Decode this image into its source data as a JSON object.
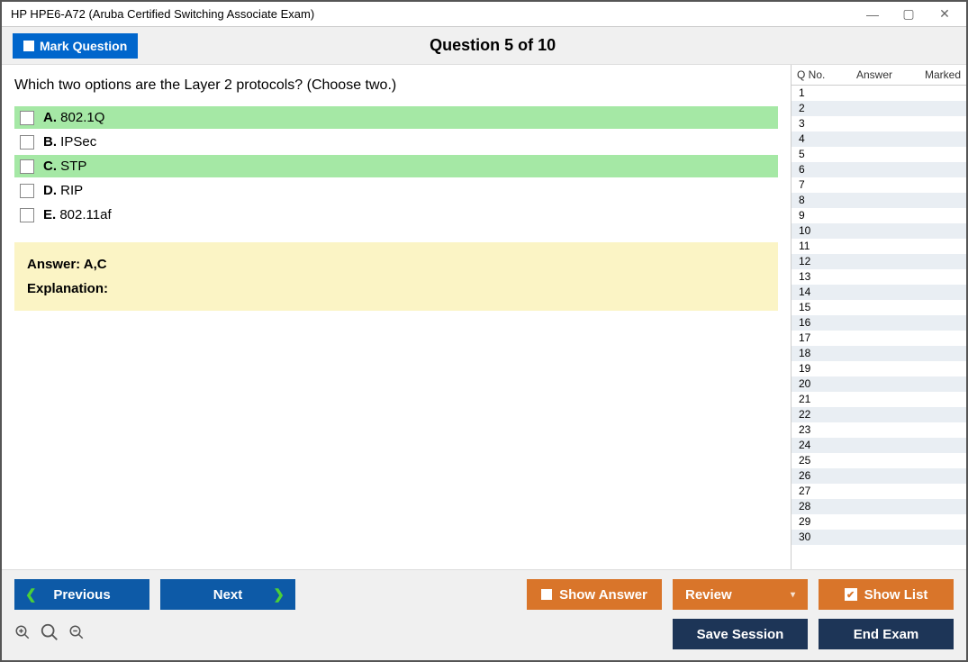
{
  "window": {
    "title": "HP HPE6-A72 (Aruba Certified Switching Associate Exam)"
  },
  "header": {
    "mark_label": "Mark Question",
    "question_title": "Question 5 of 10"
  },
  "question": {
    "text": "Which two options are the Layer 2 protocols? (Choose two.)",
    "options": [
      {
        "letter": "A.",
        "text": "802.1Q",
        "correct": true
      },
      {
        "letter": "B.",
        "text": "IPSec",
        "correct": false
      },
      {
        "letter": "C.",
        "text": "STP",
        "correct": true
      },
      {
        "letter": "D.",
        "text": "RIP",
        "correct": false
      },
      {
        "letter": "E.",
        "text": "802.11af",
        "correct": false
      }
    ],
    "answer_prefix": "Answer: ",
    "answer_value": "A,C",
    "explanation_label": "Explanation:"
  },
  "sidebar": {
    "col_qno": "Q No.",
    "col_answer": "Answer",
    "col_marked": "Marked",
    "rows": [
      {
        "n": "1"
      },
      {
        "n": "2"
      },
      {
        "n": "3"
      },
      {
        "n": "4"
      },
      {
        "n": "5"
      },
      {
        "n": "6"
      },
      {
        "n": "7"
      },
      {
        "n": "8"
      },
      {
        "n": "9"
      },
      {
        "n": "10"
      },
      {
        "n": "11"
      },
      {
        "n": "12"
      },
      {
        "n": "13"
      },
      {
        "n": "14"
      },
      {
        "n": "15"
      },
      {
        "n": "16"
      },
      {
        "n": "17"
      },
      {
        "n": "18"
      },
      {
        "n": "19"
      },
      {
        "n": "20"
      },
      {
        "n": "21"
      },
      {
        "n": "22"
      },
      {
        "n": "23"
      },
      {
        "n": "24"
      },
      {
        "n": "25"
      },
      {
        "n": "26"
      },
      {
        "n": "27"
      },
      {
        "n": "28"
      },
      {
        "n": "29"
      },
      {
        "n": "30"
      }
    ]
  },
  "footer": {
    "previous": "Previous",
    "next": "Next",
    "show_answer": "Show Answer",
    "review": "Review",
    "show_list": "Show List",
    "save_session": "Save Session",
    "end_exam": "End Exam"
  }
}
